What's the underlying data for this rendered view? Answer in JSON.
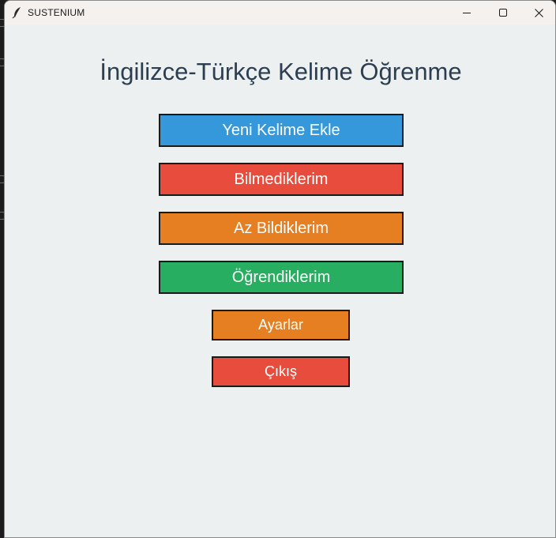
{
  "window": {
    "title": "SUSTENIUM"
  },
  "main": {
    "title": "İngilizce-Türkçe Kelime Öğrenme"
  },
  "buttons": {
    "add_word": "Yeni Kelime Ekle",
    "unknown": "Bilmediklerim",
    "little_known": "Az Bildiklerim",
    "learned": "Öğrendiklerim",
    "settings": "Ayarlar",
    "exit": "Çıkış"
  },
  "colors": {
    "background": "#ecf0f1",
    "title_text": "#2c3e50",
    "blue": "#3498db",
    "red": "#e74c3c",
    "orange": "#e67e22",
    "green": "#27ae60"
  },
  "icons": {
    "app": "feather-icon",
    "minimize": "minimize-icon",
    "maximize": "maximize-icon",
    "close": "close-icon"
  }
}
